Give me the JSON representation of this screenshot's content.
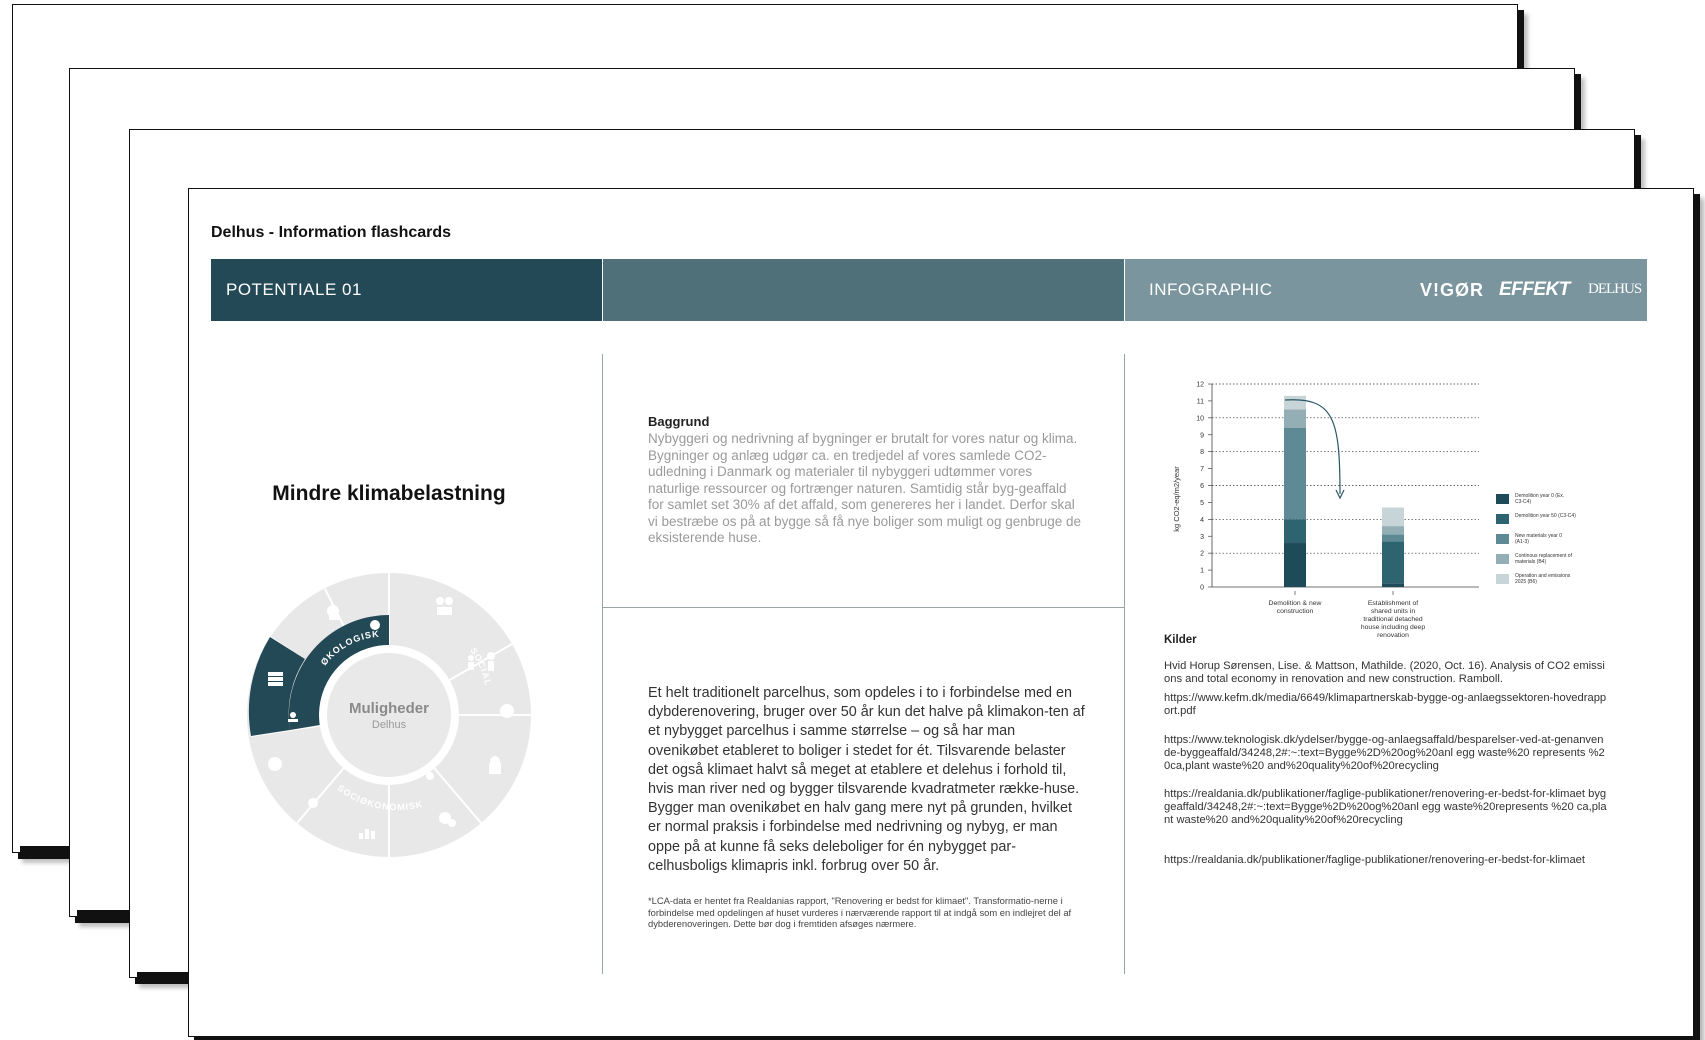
{
  "card": {
    "title": "Delhus - Information flashcards",
    "header": {
      "potential_label": "POTENTIALE 01",
      "infographic_label": "INFOGRAPHIC",
      "logos": [
        "V!GØR",
        "EFFEKT",
        "DELHUS"
      ]
    },
    "colors": {
      "dark": "#244956",
      "mid": "#4f6f79",
      "light": "#7a959d"
    },
    "left": {
      "heading": "Mindre klimabelastning",
      "wheel": {
        "center_title": "Muligheder",
        "center_subtitle": "Delhus",
        "segment_labels": [
          "ØKOLOGISK",
          "SOCIAL",
          "SOCIØKONOMISK"
        ],
        "active_segment": "ØKOLOGISK",
        "icons": [
          "building-stack-icon",
          "sprout-icon",
          "people-icon",
          "person-child-icon",
          "family-icon",
          "community-icon",
          "house-plant-icon",
          "coins-icon",
          "bar-chart-icon",
          "sun-icon",
          "piggy-bank-icon",
          "recycle-icon",
          "animal-icon",
          "tree-icon"
        ]
      }
    },
    "middle": {
      "top": {
        "heading": "Baggrund",
        "text": "Nybyggeri og nedrivning af bygninger er brutalt for vores natur og klima. Bygninger og anlæg udgør ca. en tredjedel af vores samlede CO2-udledning i Danmark og materialer til nybyggeri udtømmer vores naturlige ressourcer og fortrænger naturen. Samtidig står byg-geaffald for samlet set 30% af det affald, som genereres her i landet. Derfor skal vi bestræbe os på at bygge så få nye boliger som muligt og genbruge de eksisterende huse."
      },
      "bottom": {
        "text": "Et helt traditionelt parcelhus, som opdeles i to i forbindelse med en dybderenovering, bruger over 50 år kun det halve på klimakon-ten af et nybygget parcelhus i samme størrelse – og så har man ovenikøbet etableret to boliger i stedet for ét. Tilsvarende belaster det også klimaet halvt så meget at etablere et delehus i forhold til, hvis man river ned og bygger tilsvarende kvadratmeter række-huse. Bygger man ovenikøbet en halv gang mere nyt på grunden, hvilket er normal praksis i forbindelse med nedrivning og nybyg, er man oppe på at kunne få seks deleboliger for én nybygget par-celhusboligs klimapris inkl. forbrug over 50 år.",
        "footnote": "*LCA-data er hentet fra Realdanias rapport, \"Renovering er bedst for klimaet\". Transformatio-nerne i forbindelse med opdelingen af huset vurderes i nærværende rapport til at indgå som en indlejret del af dybderenoveringen. Dette bør dog i fremtiden afsøges nærmere."
      }
    },
    "right": {
      "sources_heading": "Kilder",
      "sources": [
        "Hvid Horup Sørensen, Lise. & Mattson, Mathilde. (2020, Oct. 16). Analysis of CO2 emissions and total economy in renovation and new construction. Ramboll.",
        "https://www.kefm.dk/media/6649/klimapartnerskab-bygge-og-anlaegssektoren-hovedrapport.pdf",
        "https://www.teknologisk.dk/ydelser/bygge-og-anlaegsaffald/besparelser-ved-at-genanvende-byggeaffald/34248,2#:~:text=Bygge%2D%20og%20anl egg waste%20 represents %20ca,plant waste%20 and%20quality%20of%20recycling",
        "https://realdania.dk/publikationer/faglige-publikationer/renovering-er-bedst-for-klimaet byggeaffald/34248,2#:~:text=Bygge%2D%20og%20anl egg waste%20represents %20 ca,plant waste%20 and%20quality%20of%20recycling",
        "https://realdania.dk/publikationer/faglige-publikationer/renovering-er-bedst-for-klimaet"
      ]
    }
  },
  "chart_data": {
    "type": "bar",
    "stacked": true,
    "categories": [
      "Demolition & new construction",
      "Establishment of shared units in traditional detached house including deep renovation"
    ],
    "ylabel": "kg CO2-eq/m2/year",
    "ylim": [
      0,
      12
    ],
    "yticks": [
      0,
      1,
      2,
      3,
      4,
      5,
      6,
      7,
      8,
      9,
      10,
      11,
      12
    ],
    "grid": "dotted horizontal",
    "legend_position": "right",
    "annotation": "curved arrow from the first bar to the second bar",
    "series": [
      {
        "name": "Demolition year 0 (Ex. C3-C4)",
        "color": "#1d4b58",
        "values": [
          2.6,
          0.2
        ]
      },
      {
        "name": "Demolition year 50 (C3-C4)",
        "color": "#2e6370",
        "values": [
          1.4,
          2.5
        ]
      },
      {
        "name": "New materials year 0 (A1-3)",
        "color": "#5d8a94",
        "values": [
          5.4,
          0.4
        ]
      },
      {
        "name": "Continous replacement of materials (B4)",
        "color": "#93aeb4",
        "values": [
          1.1,
          0.5
        ]
      },
      {
        "name": "Operation and emissions 2025 (B6)",
        "color": "#c8d5d8",
        "values": [
          0.8,
          1.1
        ]
      }
    ]
  }
}
